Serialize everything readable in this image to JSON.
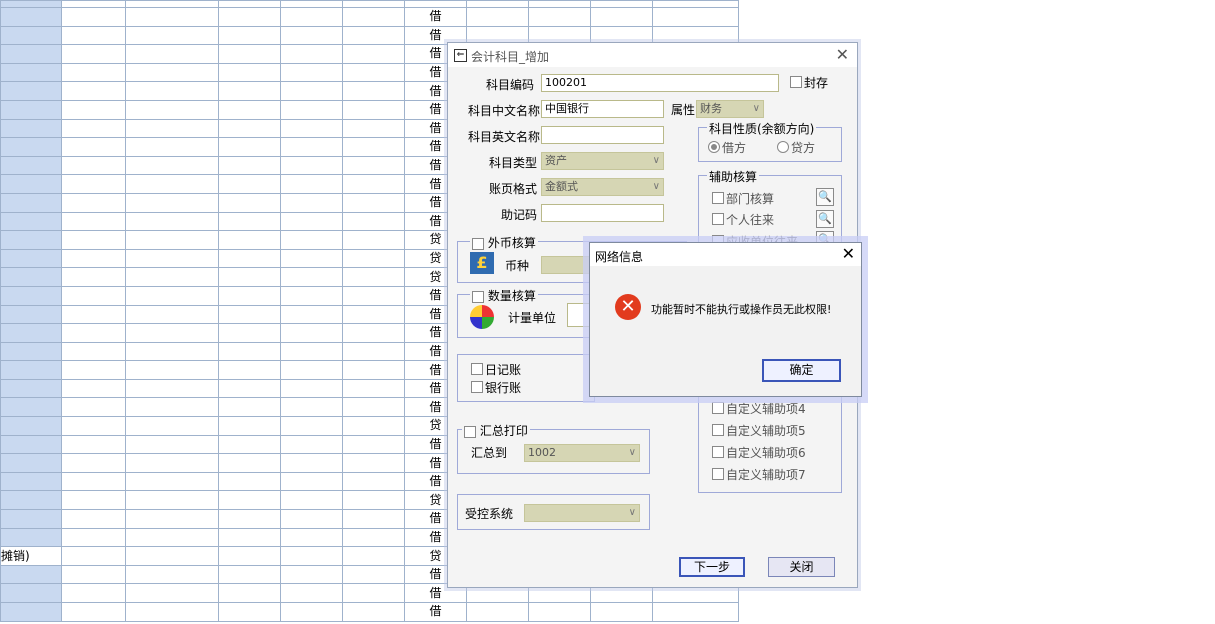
{
  "grid": {
    "directions": [
      "借",
      "借",
      "借",
      "借",
      "借",
      "借",
      "借",
      "借",
      "借",
      "借",
      "借",
      "借",
      "贷",
      "贷",
      "贷",
      "借",
      "借",
      "借",
      "借",
      "借",
      "借",
      "借",
      "贷",
      "借",
      "借",
      "借",
      "贷",
      "借",
      "借",
      "贷",
      "借",
      "借",
      "借"
    ],
    "side_label": "摊销)"
  },
  "dialog": {
    "title": "会计科目_增加",
    "code_label": "科目编码",
    "code_value": "100201",
    "seal_label": "封存",
    "cn_name_label": "科目中文名称",
    "cn_name_value": "中国银行",
    "attr_label": "属性",
    "attr_value": "财务",
    "en_name_label": "科目英文名称",
    "type_label": "科目类型",
    "type_value": "资产",
    "format_label": "账页格式",
    "format_value": "金额式",
    "memo_label": "助记码",
    "nature_title": "科目性质(余额方向)",
    "debit_label": "借方",
    "credit_label": "贷方",
    "aux_title": "辅助核算",
    "aux_items": [
      "部门核算",
      "个人往来",
      "应收单位往来"
    ],
    "aux_custom": [
      "自定义辅助项4",
      "自定义辅助项5",
      "自定义辅助项6",
      "自定义辅助项7"
    ],
    "fx_title": "外币核算",
    "currency_label": "币种",
    "qty_title": "数量核算",
    "unit_label": "计量单位",
    "journal_label": "日记账",
    "bank_label": "银行账",
    "summary_title": "汇总打印",
    "summary_to_label": "汇总到",
    "summary_to_value": "1002",
    "controlled_label": "受控系统",
    "next_button": "下一步",
    "close_button": "关闭"
  },
  "error": {
    "title": "网络信息",
    "message": "功能暂时不能执行或操作员无此权限!",
    "ok_button": "确定"
  },
  "colors": {
    "grid_header": "#c9d9f0",
    "error_icon": "#e23b1e",
    "primary_border": "#3a55b8"
  }
}
